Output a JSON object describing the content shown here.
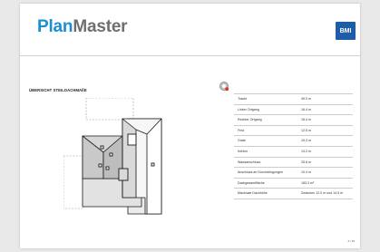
{
  "header": {
    "logo_part1": "Plan",
    "logo_part2": "Master",
    "brand_badge": "BMI",
    "colors": {
      "logo_blue": "#1a8fd6",
      "logo_gray": "#6f6f6f",
      "badge_blue": "#1e5ea8"
    }
  },
  "section": {
    "title": "ÜBERSICHT STEILDACHMAßE"
  },
  "measurements": [
    {
      "label": "Traufe",
      "value": "49.0 m"
    },
    {
      "label": "Linker Ortgang",
      "value": "16.4 m"
    },
    {
      "label": "Rechter Ortgang",
      "value": "16.4 m"
    },
    {
      "label": "First",
      "value": "12.5 m"
    },
    {
      "label": "Grate",
      "value": "19.3 m"
    },
    {
      "label": "Kehlen",
      "value": "13.2 m"
    },
    {
      "label": "Wandanschluss",
      "value": "25.6 m"
    },
    {
      "label": "Anschluss an Durchdringungen",
      "value": "10.4 m"
    },
    {
      "label": "Dachgesamtfläche",
      "value": "183.3 m²"
    },
    {
      "label": "Maximale Dachhöhe",
      "value": "Zwischen 12.0 m und 14.5 m"
    }
  ],
  "footer": {
    "page_number": "4 / 16"
  }
}
